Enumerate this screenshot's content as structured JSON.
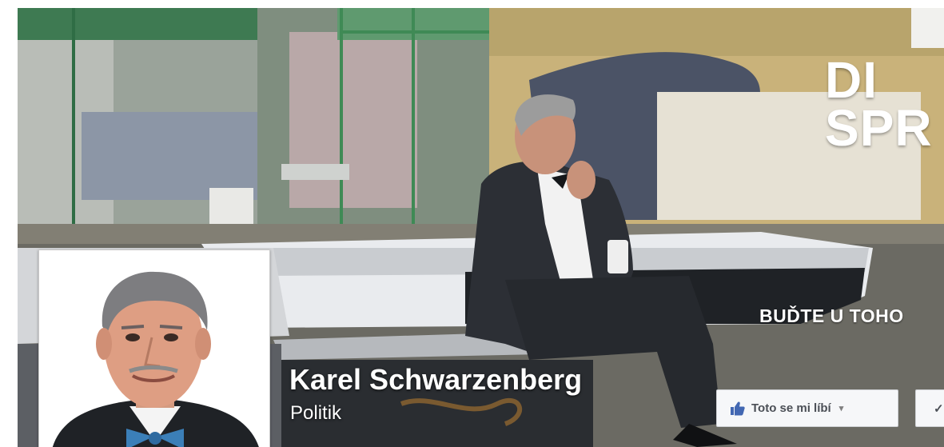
{
  "cover": {
    "headline": "DI\nSPR",
    "tagline": "BUĎTE U TOHO",
    "icons": {
      "photo": "man-in-tuxedo-on-boat"
    }
  },
  "page": {
    "name": "Karel Schwarzenberg",
    "category": "Politik"
  },
  "actions": {
    "like_label": "Toto se mi líbí",
    "like_icon": "thumbs-up-icon",
    "like_caret": "▾",
    "follow_glyph": "✓"
  },
  "colors": {
    "fb_blue": "#4267b2",
    "button_bg": "#f6f7f9",
    "button_border": "#ced0d4",
    "bowtie": "#3b7fb8"
  }
}
